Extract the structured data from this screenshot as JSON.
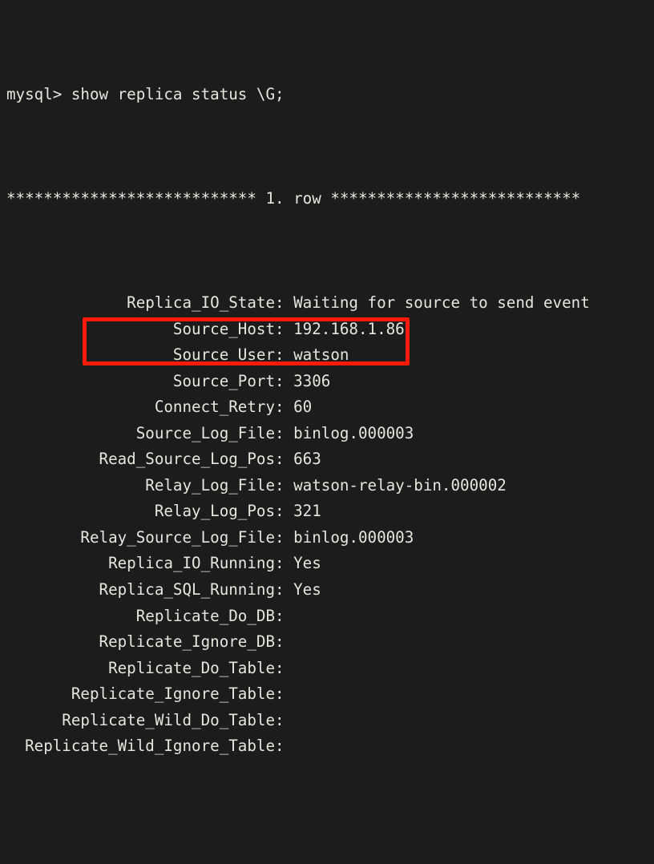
{
  "terminal": {
    "app": "mysql-client-terminal",
    "colors": {
      "background": "#1c1c1c",
      "foreground": "#e6e6de",
      "highlight": "#f91a08"
    },
    "prompt": "mysql> show replica status \\G;",
    "row_separator": "*************************** 1. row ***************************",
    "fields": [
      {
        "label": "Replica_IO_State:",
        "value": "Waiting for source to send event"
      },
      {
        "label": "Source_Host:",
        "value": "192.168.1.86"
      },
      {
        "label": "Source_User:",
        "value": "watson"
      },
      {
        "label": "Source_Port:",
        "value": "3306"
      },
      {
        "label": "Connect_Retry:",
        "value": "60"
      },
      {
        "label": "Source_Log_File:",
        "value": "binlog.000003"
      },
      {
        "label": "Read_Source_Log_Pos:",
        "value": "663"
      },
      {
        "label": "Relay_Log_File:",
        "value": "watson-relay-bin.000002"
      },
      {
        "label": "Relay_Log_Pos:",
        "value": "321"
      },
      {
        "label": "Relay_Source_Log_File:",
        "value": "binlog.000003"
      },
      {
        "label": "Replica_IO_Running:",
        "value": "Yes"
      },
      {
        "label": "Replica_SQL_Running:",
        "value": "Yes"
      },
      {
        "label": "Replicate_Do_DB:",
        "value": ""
      },
      {
        "label": "Replicate_Ignore_DB:",
        "value": ""
      },
      {
        "label": "Replicate_Do_Table:",
        "value": ""
      },
      {
        "label": "Replicate_Ignore_Table:",
        "value": ""
      },
      {
        "label": "Replicate_Wild_Do_Table:",
        "value": ""
      },
      {
        "label": "Replicate_Wild_Ignore_Table:",
        "value": ""
      }
    ],
    "label_column_width": 30,
    "highlight_annotation": {
      "name": "replica-running-highlight",
      "covers": [
        "Replica_IO_Running:",
        "Replica_SQL_Running:"
      ]
    }
  }
}
